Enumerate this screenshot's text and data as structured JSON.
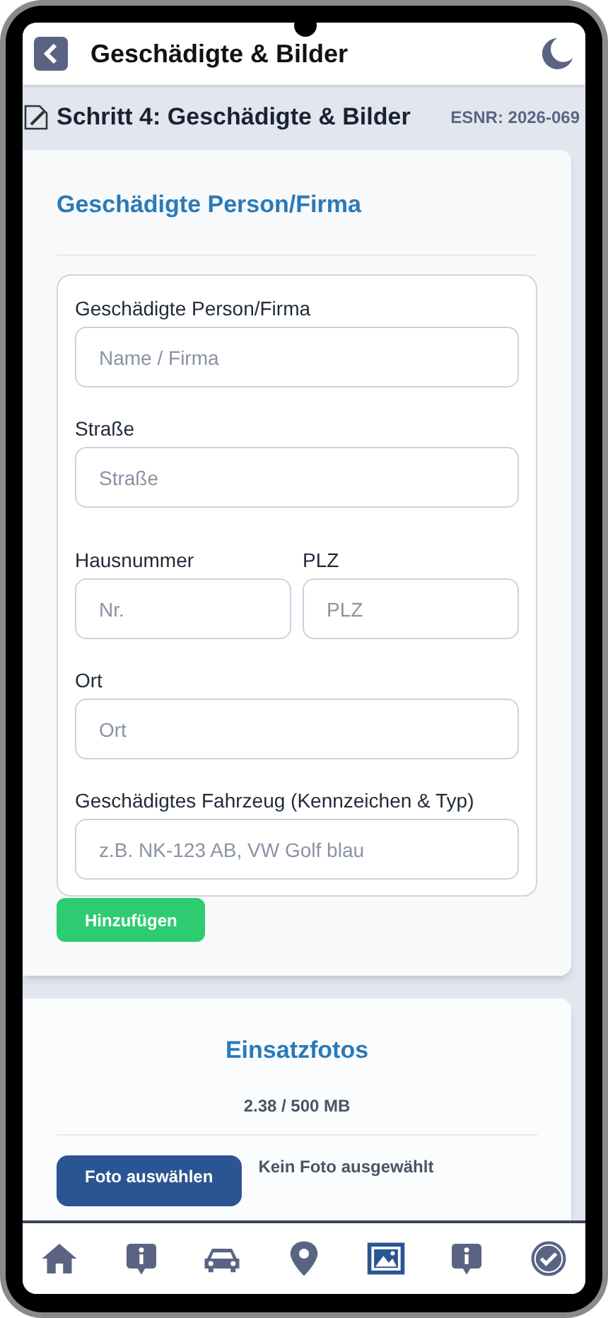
{
  "header": {
    "title": "Geschädigte & Bilder"
  },
  "step": {
    "title": "Schritt 4: Geschädigte & Bilder",
    "case_number": "ESNR: 2026-069"
  },
  "injured_card": {
    "title": "Geschädigte Person/Firma",
    "rows": [
      {
        "fields": [
          {
            "label": "Geschädigte Person/Firma",
            "placeholder": "Name / Firma"
          }
        ]
      },
      {
        "fields": [
          {
            "label": "Straße",
            "placeholder": "Straße"
          }
        ]
      },
      {
        "fields": [
          {
            "label": "Hausnummer",
            "placeholder": "Nr."
          },
          {
            "label": "PLZ",
            "placeholder": "PLZ"
          }
        ]
      },
      {
        "fields": [
          {
            "label": "Ort",
            "placeholder": "Ort"
          }
        ]
      },
      {
        "fields": [
          {
            "label": "Geschädigtes Fahrzeug (Kennzeichen & Typ)",
            "placeholder": "z.B. NK-123 AB, VW Golf blau"
          }
        ]
      }
    ],
    "add_button": "Hinzufügen"
  },
  "photos_card": {
    "title": "Einsatzfotos",
    "usage": "2.38 / 500 MB",
    "choose_button": "Foto auswählen",
    "file_status": "Kein Foto ausgewählt"
  },
  "bottom_nav": [
    {
      "selected": false
    },
    {
      "selected": false
    },
    {
      "selected": false
    },
    {
      "selected": false
    },
    {
      "selected": true
    },
    {
      "selected": false
    },
    {
      "selected": false
    }
  ]
}
